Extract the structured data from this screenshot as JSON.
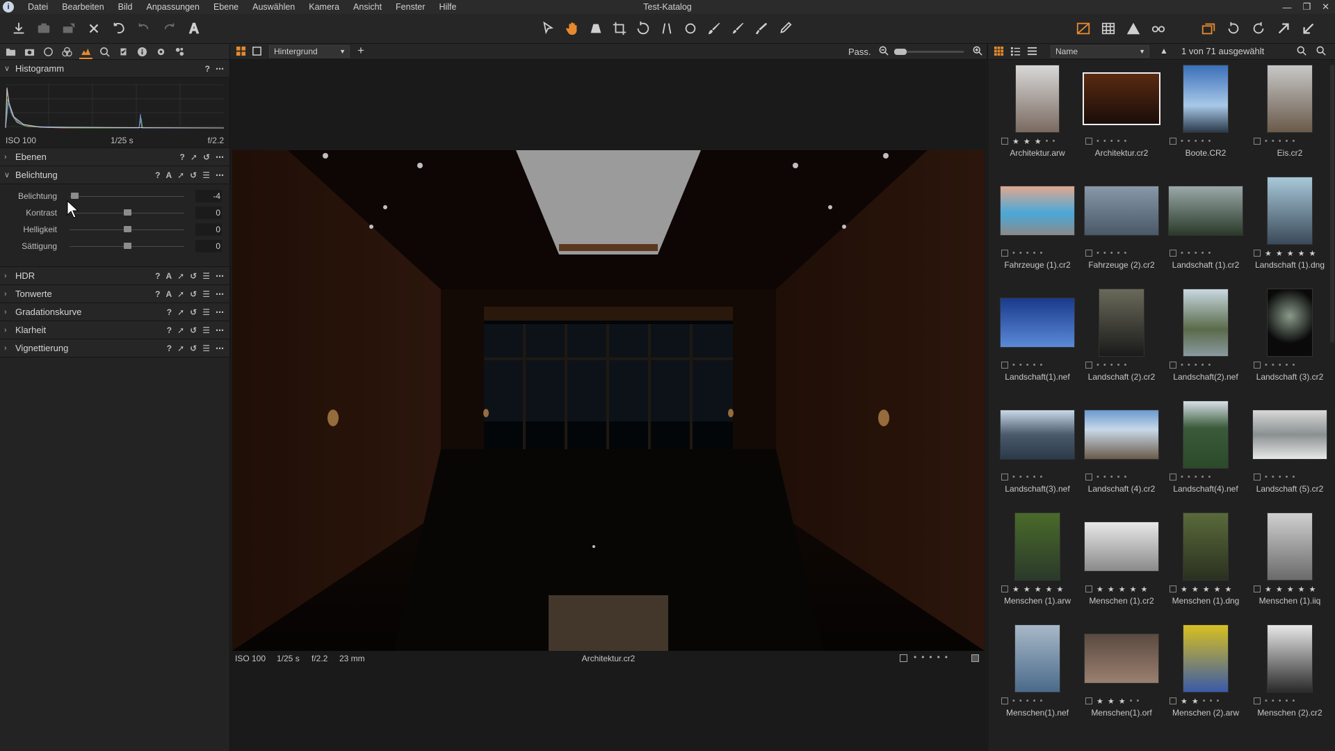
{
  "menu": [
    "Datei",
    "Bearbeiten",
    "Bild",
    "Anpassungen",
    "Ebene",
    "Auswählen",
    "Kamera",
    "Ansicht",
    "Fenster",
    "Hilfe"
  ],
  "window_title": "Test-Katalog",
  "colors": {
    "accent": "#e68a2e",
    "panel": "#232323",
    "background": "#1a1a1a",
    "text": "#c8c8c8"
  },
  "left_panel": {
    "histogram": {
      "title": "Histogramm",
      "iso": "ISO 100",
      "shutter": "1/25 s",
      "aperture": "f/2.2",
      "help": "?"
    },
    "sections_before": [
      {
        "title": "Ebenen"
      }
    ],
    "exposure": {
      "title": "Belichtung",
      "sliders": [
        {
          "label": "Belichtung",
          "value": "-4",
          "fraction": 0.04
        },
        {
          "label": "Kontrast",
          "value": "0",
          "fraction": 0.5
        },
        {
          "label": "Helligkeit",
          "value": "0",
          "fraction": 0.5
        },
        {
          "label": "Sättigung",
          "value": "0",
          "fraction": 0.5
        }
      ]
    },
    "sections_after": [
      {
        "title": "HDR"
      },
      {
        "title": "Tonwerte"
      },
      {
        "title": "Gradationskurve"
      },
      {
        "title": "Klarheit"
      },
      {
        "title": "Vignettierung"
      }
    ]
  },
  "viewer": {
    "layer_select": "Hintergrund",
    "zoom_label": "Pass.",
    "info": {
      "iso": "ISO 100",
      "shutter": "1/25 s",
      "aperture": "f/2.2",
      "focal": "23 mm",
      "filename": "Architektur.cr2"
    }
  },
  "browser": {
    "sort": "Name",
    "selection": "1 von 71 ausgewählt",
    "thumbnails": [
      {
        "name": "Architektur.arw",
        "stars": 3,
        "selected": false,
        "w": 62,
        "h": 96,
        "bg": "linear-gradient(#d8d8d8,#7a6a60)"
      },
      {
        "name": "Architektur.cr2",
        "stars": 0,
        "selected": true,
        "w": 108,
        "h": 72,
        "bg": "linear-gradient(#5a2a12,#1a0d08)"
      },
      {
        "name": "Boote.CR2",
        "stars": 0,
        "selected": false,
        "w": 64,
        "h": 96,
        "bg": "linear-gradient(#3a6fb8,#a8c8e8 60%,#2a3a4a)"
      },
      {
        "name": "Eis.cr2",
        "stars": 0,
        "selected": false,
        "w": 64,
        "h": 96,
        "bg": "linear-gradient(#c8c8c8,#6a5a4a)"
      },
      {
        "name": "Fahrzeuge (1).cr2",
        "stars": 0,
        "selected": false,
        "w": 106,
        "h": 70,
        "bg": "linear-gradient(#e0a890,#4aa8d8 55%,#8a8a8a)"
      },
      {
        "name": "Fahrzeuge (2).cr2",
        "stars": 0,
        "selected": false,
        "w": 106,
        "h": 70,
        "bg": "linear-gradient(#8898a8,#4a5868)"
      },
      {
        "name": "Landschaft (1).cr2",
        "stars": 0,
        "selected": false,
        "w": 106,
        "h": 70,
        "bg": "linear-gradient(#9aa8a8,#2a3a2a)"
      },
      {
        "name": "Landschaft (1).dng",
        "stars": 5,
        "selected": false,
        "w": 64,
        "h": 96,
        "bg": "linear-gradient(#a8c8d8,#3a4a5a)"
      },
      {
        "name": "Landschaft(1).nef",
        "stars": 0,
        "selected": false,
        "w": 106,
        "h": 70,
        "bg": "linear-gradient(#1a3a8a,#5a8ad8)"
      },
      {
        "name": "Landschaft (2).cr2",
        "stars": 0,
        "selected": false,
        "w": 64,
        "h": 96,
        "bg": "linear-gradient(#6a6a5a,#1a1a1a)"
      },
      {
        "name": "Landschaft(2).nef",
        "stars": 0,
        "selected": false,
        "w": 64,
        "h": 96,
        "bg": "linear-gradient(#c8d8e0,#5a6a4a 60%,#8a9aa0)"
      },
      {
        "name": "Landschaft (3).cr2",
        "stars": 0,
        "selected": false,
        "w": 64,
        "h": 96,
        "bg": "radial-gradient(circle at 50% 40%,#8a9a8a,#0a0a0a 60%)"
      },
      {
        "name": "Landschaft(3).nef",
        "stars": 0,
        "selected": false,
        "w": 106,
        "h": 70,
        "bg": "linear-gradient(#c8d8e8,#4a5a6a 50%,#2a3a4a)"
      },
      {
        "name": "Landschaft (4).cr2",
        "stars": 0,
        "selected": false,
        "w": 106,
        "h": 70,
        "bg": "linear-gradient(#6a9ad0,#c8d8e8 40%,#6a5a4a)"
      },
      {
        "name": "Landschaft(4).nef",
        "stars": 0,
        "selected": false,
        "w": 64,
        "h": 96,
        "bg": "linear-gradient(#d8e0e8,#3a5a3a 40%,#2a4a2a)"
      },
      {
        "name": "Landschaft (5).cr2",
        "stars": 0,
        "selected": false,
        "w": 106,
        "h": 70,
        "bg": "linear-gradient(#d8d8d8,#8a9090 50%,#e8e8e8)"
      },
      {
        "name": "Menschen (1).arw",
        "stars": 5,
        "selected": false,
        "w": 64,
        "h": 96,
        "bg": "linear-gradient(#4a6a2a,#2a3a2a)"
      },
      {
        "name": "Menschen (1).cr2",
        "stars": 5,
        "selected": false,
        "w": 106,
        "h": 70,
        "bg": "linear-gradient(#e8e8e8,#8a8a8a)"
      },
      {
        "name": "Menschen (1).dng",
        "stars": 5,
        "selected": false,
        "w": 64,
        "h": 96,
        "bg": "linear-gradient(#5a6a3a,#2a3020)"
      },
      {
        "name": "Menschen (1).iiq",
        "stars": 5,
        "selected": false,
        "w": 64,
        "h": 96,
        "bg": "linear-gradient(#d0d0d0,#6a6a6a)"
      },
      {
        "name": "Menschen(1).nef",
        "stars": 0,
        "selected": false,
        "w": 64,
        "h": 96,
        "bg": "linear-gradient(#a8b8c8,#4a6a8a)"
      },
      {
        "name": "Menschen(1).orf",
        "stars": 3,
        "selected": false,
        "w": 106,
        "h": 70,
        "bg": "linear-gradient(#5a4a40,#9a8070)"
      },
      {
        "name": "Menschen (2).arw",
        "stars": 2,
        "selected": false,
        "w": 64,
        "h": 96,
        "bg": "linear-gradient(#d8c020,#3a5aa8)"
      },
      {
        "name": "Menschen (2).cr2",
        "stars": 0,
        "selected": false,
        "w": 64,
        "h": 96,
        "bg": "linear-gradient(#e8e8e8,#2a2a2a)"
      }
    ]
  }
}
